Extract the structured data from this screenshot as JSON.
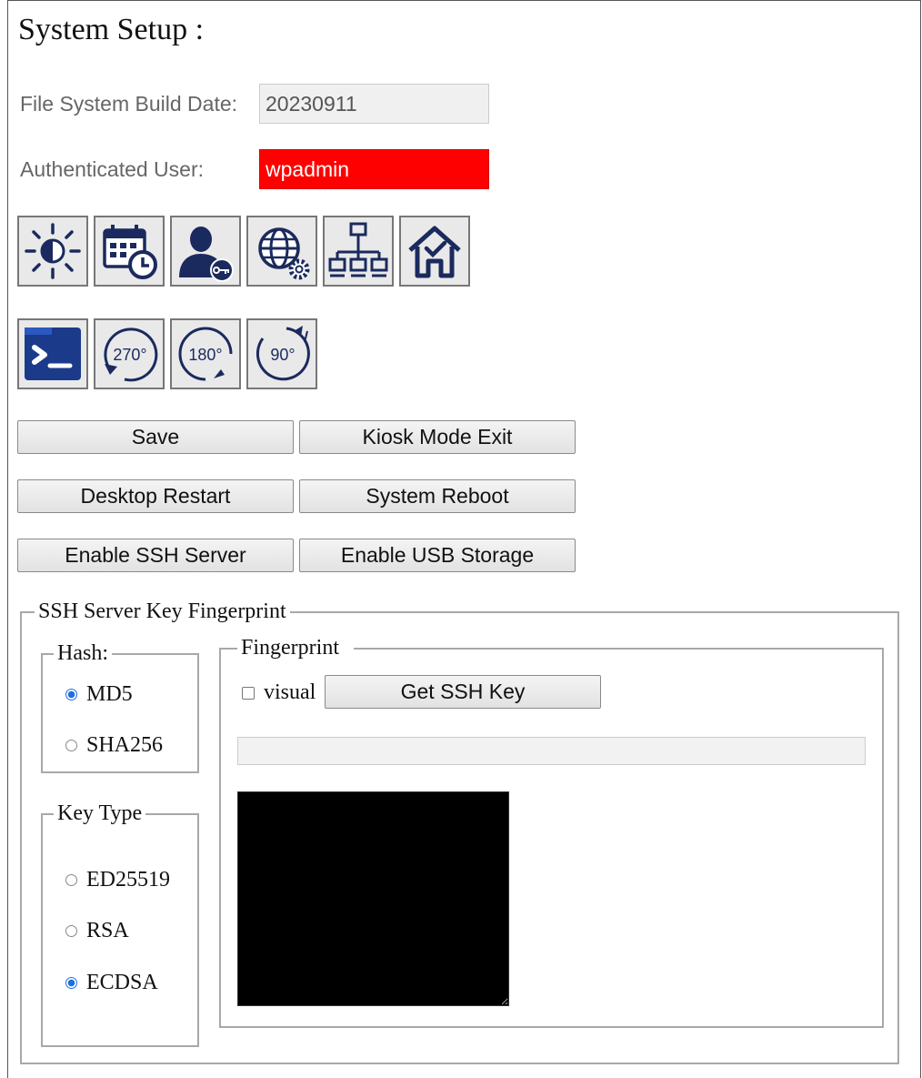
{
  "page": {
    "title": "System Setup :"
  },
  "build": {
    "label": "File System Build Date:",
    "value": "20230911"
  },
  "auth": {
    "label": "Authenticated User:",
    "value": "wpadmin"
  },
  "icon_row1": [
    {
      "name": "brightness-icon"
    },
    {
      "name": "calendar-clock-icon"
    },
    {
      "name": "user-key-icon"
    },
    {
      "name": "globe-settings-icon"
    },
    {
      "name": "network-icon"
    },
    {
      "name": "home-check-icon"
    }
  ],
  "rotation": {
    "r270": "270°",
    "r180": "180°",
    "r90": "90°"
  },
  "buttons": {
    "save": "Save",
    "kiosk_exit": "Kiosk Mode Exit",
    "desktop_restart": "Desktop Restart",
    "system_reboot": "System Reboot",
    "enable_ssh": "Enable SSH Server",
    "enable_usb": "Enable USB Storage"
  },
  "ssh": {
    "legend": "SSH Server Key Fingerprint",
    "hash": {
      "legend": "Hash:",
      "options": [
        {
          "label": "MD5",
          "checked": true
        },
        {
          "label": "SHA256",
          "checked": false
        }
      ]
    },
    "key_type": {
      "legend": "Key Type",
      "options": [
        {
          "label": "ED25519",
          "checked": false
        },
        {
          "label": "RSA",
          "checked": false
        },
        {
          "label": "ECDSA",
          "checked": true
        }
      ]
    },
    "fingerprint": {
      "legend": "Fingerprint",
      "visual_label": "visual",
      "visual_checked": false,
      "get_key_label": "Get SSH Key",
      "fingerprint_value": "",
      "output_text": ""
    }
  },
  "colors": {
    "accent_navy": "#1b2a5e",
    "alert_red": "#ff0000",
    "radio_blue": "#1e6fe0"
  }
}
